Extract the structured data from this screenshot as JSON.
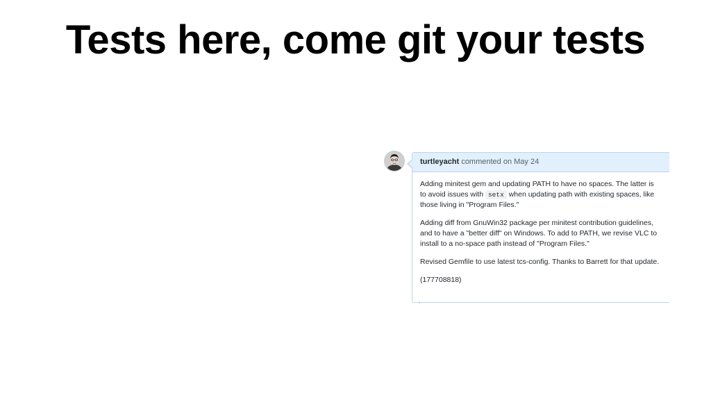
{
  "slide": {
    "title": "Tests here, come git your tests"
  },
  "comment": {
    "author": "turtleyacht",
    "meta": "commented on May 24",
    "paragraphs": {
      "p1_before": "Adding minitest gem and updating PATH to have no spaces. The latter is to avoid issues with",
      "p1_code": "setx",
      "p1_after": "when updating path with existing spaces, like those living in \"Program Files.\"",
      "p2": "Adding diff from GnuWin32 package per minitest contribution guidelines, and to have a \"better diff\" on Windows. To add to PATH, we revise VLC to install to a no-space path instead of \"Program Files.\"",
      "p3": "Revised Gemfile to use latest tcs-config. Thanks to Barrett for that update.",
      "p4": "(177708818)"
    }
  },
  "colors": {
    "header_bg": "#e1f0fc",
    "border": "#c0d3eb",
    "text": "#24292e",
    "meta_text": "#586069"
  },
  "icons": {
    "avatar": "user-avatar"
  }
}
